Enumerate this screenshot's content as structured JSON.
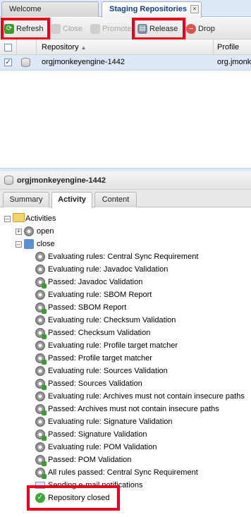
{
  "tabs": [
    {
      "label": "Welcome"
    },
    {
      "label": "Staging Repositories"
    }
  ],
  "toolbar": {
    "refresh": "Refresh",
    "close": "Close",
    "promote": "Promote",
    "release": "Release",
    "drop": "Drop"
  },
  "grid": {
    "columns": [
      "Repository",
      "Profile"
    ],
    "rows": [
      {
        "repository": "orgjmonkeyengine-1442",
        "profile": "org.jmonk",
        "checked": true
      }
    ]
  },
  "detail": {
    "title": "orgjmonkeyengine-1442",
    "tabs": [
      "Summary",
      "Activity",
      "Content"
    ],
    "active_tab": "Activity"
  },
  "tree": {
    "root": "Activities",
    "open": "open",
    "close": "close",
    "events": [
      "Evaluating rules: Central Sync Requirement",
      "Evaluating rule: Javadoc Validation",
      "Passed: Javadoc Validation",
      "Evaluating rule: SBOM Report",
      "Passed: SBOM Report",
      "Evaluating rule: Checksum Validation",
      "Passed: Checksum Validation",
      "Evaluating rule: Profile target matcher",
      "Passed: Profile target matcher",
      "Evaluating rule: Sources Validation",
      "Passed: Sources Validation",
      "Evaluating rule: Archives must not contain insecure paths",
      "Passed: Archives must not contain insecure paths",
      "Evaluating rule: Signature Validation",
      "Passed: Signature Validation",
      "Evaluating rule: POM Validation",
      "Passed: POM Validation",
      "All rules passed: Central Sync Requirement",
      "Sending e-mail notifications",
      "Repository closed"
    ]
  },
  "colors": {
    "highlight": "#e8001c",
    "accent": "#15428b"
  }
}
